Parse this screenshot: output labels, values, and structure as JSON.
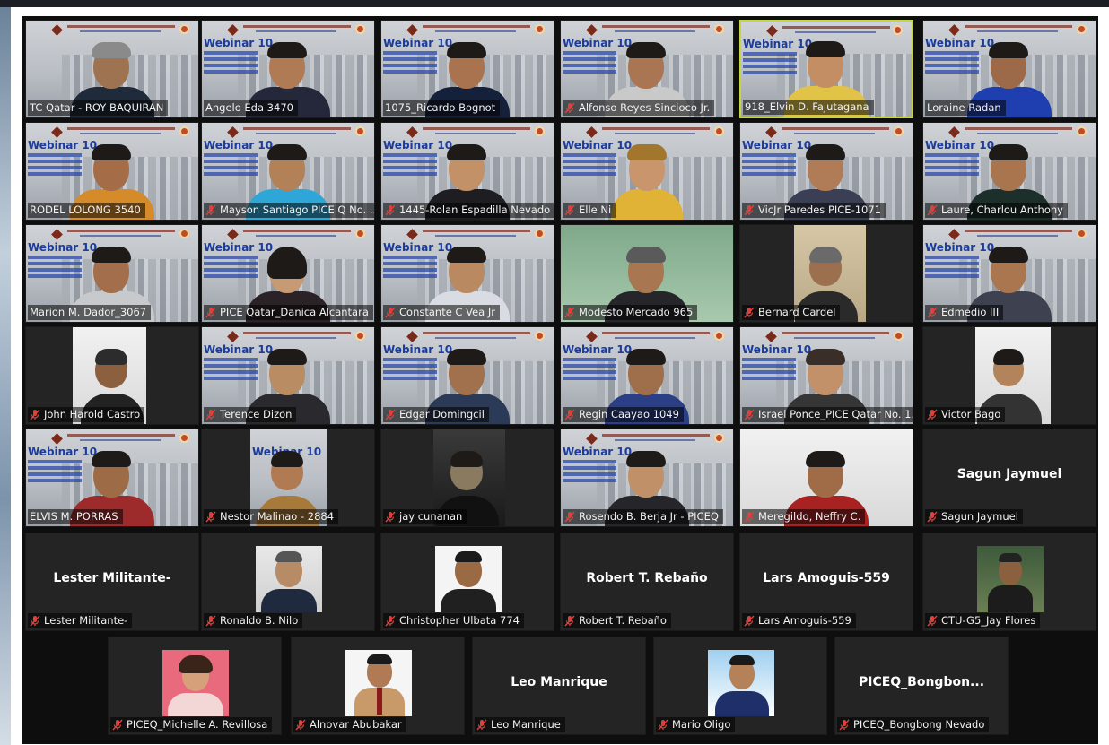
{
  "tiles": [
    {
      "name": "TC Qatar - ROY BAQUIRAN"
    },
    {
      "name": "Angelo Eda 3470"
    },
    {
      "name": "1075_Ricardo Bognot"
    },
    {
      "name": "Alfonso Reyes Sincioco Jr."
    },
    {
      "name": "918_Elvin D. Fajutagana"
    },
    {
      "name": "Loraine Radan"
    },
    {
      "name": "RODEL LOLONG 3540"
    },
    {
      "name": "Mayson Santiago PICE Q No. ..."
    },
    {
      "name": "1445-Rolan Espadilla Nevado"
    },
    {
      "name": "Elle Ni"
    },
    {
      "name": "VicJr Paredes PICE-1071"
    },
    {
      "name": "Laure, Charlou Anthony"
    },
    {
      "name": "Marion M. Dador_3067"
    },
    {
      "name": "PICE Qatar_Danica Alcantara"
    },
    {
      "name": "Constante C Vea Jr"
    },
    {
      "name": "Modesto Mercado 965"
    },
    {
      "name": "Bernard Cardel"
    },
    {
      "name": "Edmedio III"
    },
    {
      "name": "John Harold Castro"
    },
    {
      "name": "Terence Dizon"
    },
    {
      "name": "Edgar Domingcil"
    },
    {
      "name": "Regin Caayao 1049"
    },
    {
      "name": "Israel Ponce_PICE Qatar No. 1..."
    },
    {
      "name": "Victor Bago"
    },
    {
      "name": "ELVIS M. PORRAS"
    },
    {
      "name": "Nestor Malinao - 2884"
    },
    {
      "name": "jay cunanan"
    },
    {
      "name": "Rosendo B. Berja Jr - PICEQ"
    },
    {
      "name": "Meregildo, Neffry C."
    },
    {
      "name": "Sagun Jaymuel",
      "display": "Sagun Jaymuel"
    },
    {
      "name": "Lester Militante-",
      "display": "Lester Militante-"
    },
    {
      "name": "Ronaldo B. Nilo"
    },
    {
      "name": "Christopher Ulbata 774"
    },
    {
      "name": "Robert T. Rebaño",
      "display": "Robert T. Rebaño"
    },
    {
      "name": "Lars Amoguis-559",
      "display": "Lars Amoguis-559"
    },
    {
      "name": "CTU-G5_Jay Flores"
    },
    {
      "name": "PICEQ_Michelle A. Revillosa"
    },
    {
      "name": "Alnovar Abubakar"
    },
    {
      "name": "Leo Manrique",
      "display": "Leo Manrique"
    },
    {
      "name": "Mario Oligo"
    },
    {
      "name": "PICEQ_Bongbong Nevado",
      "display": "PICEQ_Bongbon..."
    }
  ],
  "webinar": {
    "title": "Webinar 10"
  },
  "colors": {
    "muted_mic": "#e0403a",
    "active_speaker_border": "#c7d63c",
    "webinar_title": "#1c3c9c"
  }
}
